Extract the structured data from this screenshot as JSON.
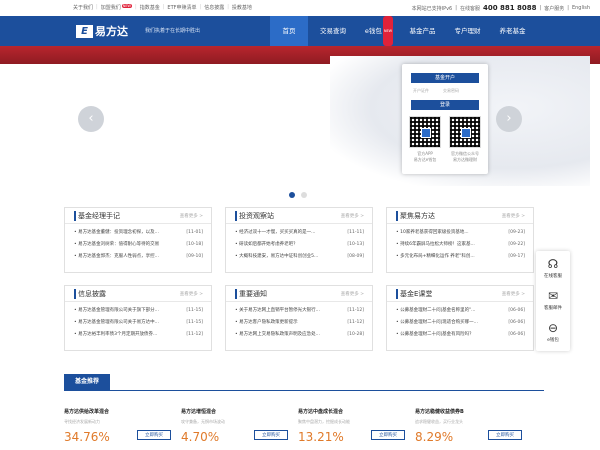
{
  "topbar": {
    "left": [
      "关于我们",
      "加盟我们",
      "指数基金",
      "ETF申赎清单",
      "信息披露",
      "投教基地"
    ],
    "right_note": "本网站已支持IPv6",
    "hotline_label": "在线客服",
    "hotline": "400 881 8088",
    "service": "客户服务",
    "lang": "English",
    "hot_badge": "NEW"
  },
  "nav": {
    "logo": "易方达",
    "logo_mark": "E",
    "slogan": "我们执着于在长期中胜出",
    "menu": [
      "首页",
      "交易查询",
      "e钱包",
      "基金产品",
      "专户理财",
      "养老基金"
    ],
    "active": "首页",
    "accent": "#1c4f9c"
  },
  "login": {
    "open_account": "基金开户",
    "field1": "开户证件",
    "field2": "交易密码",
    "login": "登录",
    "qr1_cap": "官方APP\n易方达e钱包",
    "qr2_cap": "官方微信公众号\n易方达微理财"
  },
  "panels": [
    {
      "title": "基金经理手记",
      "more": "查看更多 >",
      "items": [
        {
          "text": "易方达基金董健：投资理念初探，以及...",
          "date": "[11-01]"
        },
        {
          "text": "易方达基金刘树荣：值得耐心等待的交易",
          "date": "[10-18]"
        },
        {
          "text": "易方达基金郭杰：克服人性弱点，享控...",
          "date": "[09-10]"
        }
      ]
    },
    {
      "title": "投资观察站",
      "more": "查看更多 >",
      "items": [
        {
          "text": "经济过双十一才慢，买买买真的是一...",
          "date": "[11-11]"
        },
        {
          "text": "研读如后都开始考虑养老吧？",
          "date": "[10-13]"
        },
        {
          "text": "大概科技建安，易方达中证科创创业5...",
          "date": "[08-09]"
        }
      ]
    },
    {
      "title": "聚焦易方达",
      "more": "查看更多 >",
      "items": [
        {
          "text": "10家养老基获得回家级投资基地...",
          "date": "[09-23]"
        },
        {
          "text": "持续6年霸屏马拉松大师榜！这家基...",
          "date": "[09-22]"
        },
        {
          "text": "多元化布局+精细化运作 养老\"科创...",
          "date": "[09-17]"
        }
      ]
    },
    {
      "title": "信息披露",
      "more": "查看更多 >",
      "items": [
        {
          "text": "易方达基金管理有限公司关于旗下部分...",
          "date": "[11-15]"
        },
        {
          "text": "易方达基金管理有限公司关于易方达中...",
          "date": "[11-15]"
        },
        {
          "text": "易方达裕丰利率债3个月定期开放债券...",
          "date": "[11-12]"
        }
      ]
    },
    {
      "title": "重要通知",
      "more": "查看更多 >",
      "items": [
        {
          "text": "关于易方达网上直销平台暂停光大银行...",
          "date": "[11-12]"
        },
        {
          "text": "易方达客户隐私政策更新提示",
          "date": "[11-12]"
        },
        {
          "text": "易方达网上交易隐私政策声明及应急处...",
          "date": "[10-28]"
        }
      ]
    },
    {
      "title": "基金E课堂",
      "more": "查看更多 >",
      "items": [
        {
          "text": "公募基金理财二十问|基金名称里的\"...",
          "date": "[06-06]"
        },
        {
          "text": "公募基金理财二十问|现适合购买哪一...",
          "date": "[06-06]"
        },
        {
          "text": "公募基金理财二十问|基金有风险吗？",
          "date": "[06-06]"
        }
      ]
    }
  ],
  "side": [
    {
      "icon": "headset",
      "label": "在线客服"
    },
    {
      "icon": "mail",
      "label": "客服邮件"
    },
    {
      "icon": "ewallet",
      "label": "e钱包"
    }
  ],
  "funds": {
    "tag": "基金推荐",
    "items": [
      {
        "name": "易方达供给改革混合",
        "slogan": "寻找经济发展新动力",
        "value": "34.76%",
        "btn": "立即购买"
      },
      {
        "name": "易方达增恒混合",
        "slogan": "攻守兼备，无惧市场波动",
        "value": "4.70%",
        "btn": "立即购买"
      },
      {
        "name": "易方达中盘成长混合",
        "slogan": "聚焦中盘潜力，挖掘成长动能",
        "value": "13.21%",
        "btn": "立即购买"
      },
      {
        "name": "易方达稳健收益债券B",
        "slogan": "追求稳健收益，买行业龙头",
        "value": "8.29%",
        "btn": "立即购买"
      }
    ]
  }
}
